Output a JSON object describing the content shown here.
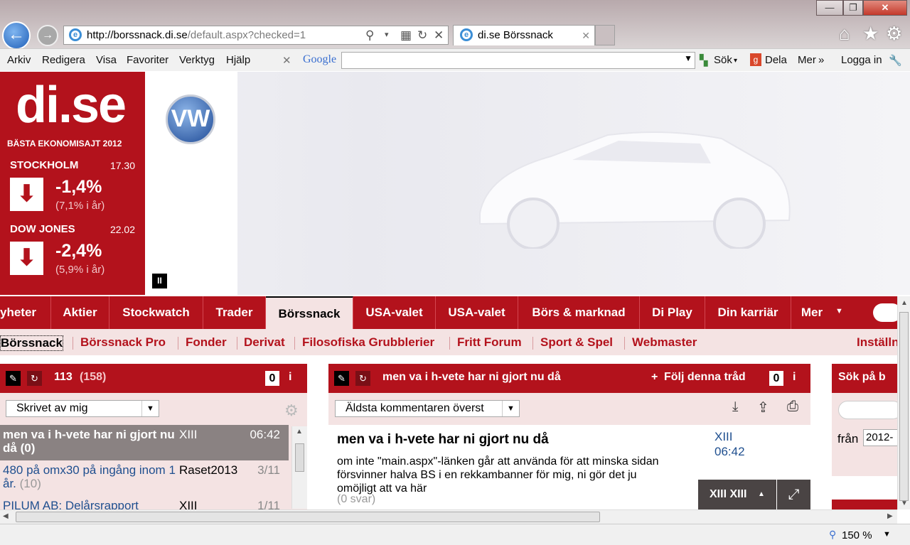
{
  "browser": {
    "url_host": "http://borssnack.di.se",
    "url_path": "/default.aspx?checked=1",
    "tab_title": "di.se Börssnack",
    "menus": [
      "Arkiv",
      "Redigera",
      "Visa",
      "Favoriter",
      "Verktyg",
      "Hjälp"
    ],
    "google_label": "Google",
    "search_label": "Sök",
    "share_label": "Dela",
    "more_label": "Mer",
    "login_label": "Logga in",
    "zoom": "150 %"
  },
  "ticker": {
    "logo": "di.se",
    "tagline": "BÄSTA EKONOMISAJT 2012",
    "markets": [
      {
        "name": "STOCKHOLM",
        "time": "17.30",
        "change": "-1,4%",
        "ytd": "(7,1% i år)"
      },
      {
        "name": "DOW JONES",
        "time": "22.02",
        "change": "-2,4%",
        "ytd": "(5,9% i år)"
      }
    ]
  },
  "topnav": [
    "yheter",
    "Aktier",
    "Stockwatch",
    "Trader",
    "Börssnack",
    "USA-valet",
    "USA-valet",
    "Börs & marknad",
    "Di Play",
    "Din karriär",
    "Mer"
  ],
  "subnav": [
    "Börssnack",
    "Börssnack Pro",
    "Fonder",
    "Derivat",
    "Filosofiska Grubblerier",
    "Fritt Forum",
    "Sport & Spel",
    "Webmaster"
  ],
  "settings_label": "Inställn",
  "list_panel": {
    "count_main": "113",
    "count_total": "(158)",
    "badge": "0",
    "filter": "Skrivet av mig",
    "rows": [
      {
        "title": "men va i h-vete har ni gjort nu då",
        "replies": "(0)",
        "author": "XIII",
        "date": "06:42"
      },
      {
        "title": "480 på omx30 på ingång inom 1 år.",
        "replies": "(10)",
        "author": "Raset2013",
        "date": "3/11"
      },
      {
        "title": "PILUM AB: Delårsrapport",
        "replies": "",
        "author": "XIII",
        "date": "1/11"
      }
    ]
  },
  "thread_panel": {
    "title": "men va i h-vete har ni gjort nu då",
    "follow_label": "Följ denna tråd",
    "badge": "0",
    "sort": "Äldsta kommentaren överst",
    "post_title": "men va i h-vete har ni gjort nu då",
    "post_body": "om inte \"main.aspx\"-länken går att använda för att minska sidan försvinner halva BS i en rekkambanner för mig, ni gör det ju omöjligt att va här",
    "post_replies": "(0 svar)",
    "author": "XIII",
    "time": "06:42",
    "user_button": "XIII XIII"
  },
  "search_panel": {
    "title": "Sök på b",
    "from_label": "från",
    "from_value": "2012-"
  }
}
